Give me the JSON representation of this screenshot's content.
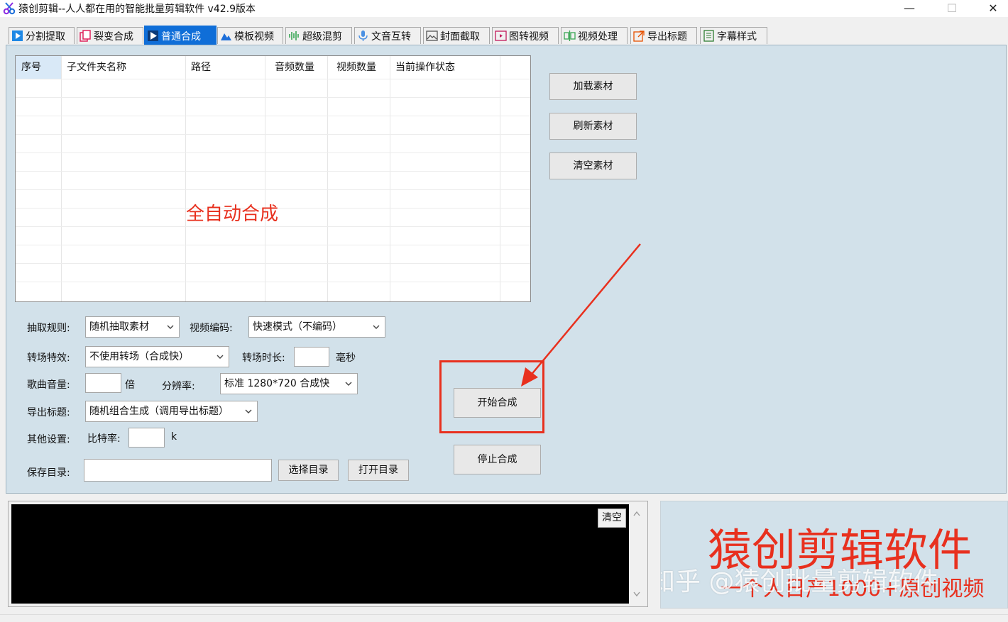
{
  "window": {
    "title": "猿创剪辑--人人都在用的智能批量剪辑软件   v42.9版本",
    "minimize": "—",
    "maximize": "☐",
    "close": "✕"
  },
  "tabs": [
    {
      "label": "分割提取",
      "icon": "play-square-icon",
      "active": false
    },
    {
      "label": "裂变合成",
      "icon": "copy-icon",
      "active": false
    },
    {
      "label": "普通合成",
      "icon": "play-icon",
      "active": true
    },
    {
      "label": "模板视频",
      "icon": "mountain-icon",
      "active": false
    },
    {
      "label": "超级混剪",
      "icon": "waveform-icon",
      "active": false
    },
    {
      "label": "文音互转",
      "icon": "microphone-icon",
      "active": false
    },
    {
      "label": "封面截取",
      "icon": "image-icon",
      "active": false
    },
    {
      "label": "图转视频",
      "icon": "photo-video-icon",
      "active": false
    },
    {
      "label": "视频处理",
      "icon": "split-icon",
      "active": false
    },
    {
      "label": "导出标题",
      "icon": "export-icon",
      "active": false
    },
    {
      "label": "字幕样式",
      "icon": "document-icon",
      "active": false
    }
  ],
  "table": {
    "columns": [
      "序号",
      "子文件夹名称",
      "路径",
      "音频数量",
      "视频数量",
      "当前操作状态"
    ],
    "rows": []
  },
  "overlay": {
    "grid_note": "全自动合成",
    "promo_title": "猿创剪辑软件",
    "promo_sub": "一个人日产1000+原创视频",
    "watermark": "知乎 @猿创批量剪辑软件"
  },
  "side_buttons": {
    "load": "加载素材",
    "refresh": "刷新素材",
    "clear": "清空素材"
  },
  "form": {
    "extract_rule_label": "抽取规则:",
    "extract_rule_value": "随机抽取素材",
    "video_codec_label": "视频编码:",
    "video_codec_value": "快速模式（不编码）",
    "transition_label": "转场特效:",
    "transition_value": "不使用转场（合成快）",
    "transition_duration_label": "转场时长:",
    "transition_duration_value": "",
    "ms_unit": "毫秒",
    "music_volume_label": "歌曲音量:",
    "music_volume_value": "",
    "times_unit": "倍",
    "resolution_label": "分辨率:",
    "resolution_value": "标准 1280*720 合成快",
    "export_title_label": "导出标题:",
    "export_title_value": "随机组合生成（调用导出标题）",
    "other_label": "其他设置:",
    "bitrate_label": "比特率:",
    "bitrate_value": "",
    "bitrate_unit": "k",
    "save_dir_label": "保存目录:",
    "save_dir_value": "",
    "choose_dir": "选择目录",
    "open_dir": "打开目录"
  },
  "actions": {
    "start": "开始合成",
    "stop": "停止合成",
    "log_clear": "清空"
  },
  "colors": {
    "panel_bg": "#d2e1ea",
    "active_tab": "#0f6ed8",
    "highlight_red": "#e8301e"
  }
}
